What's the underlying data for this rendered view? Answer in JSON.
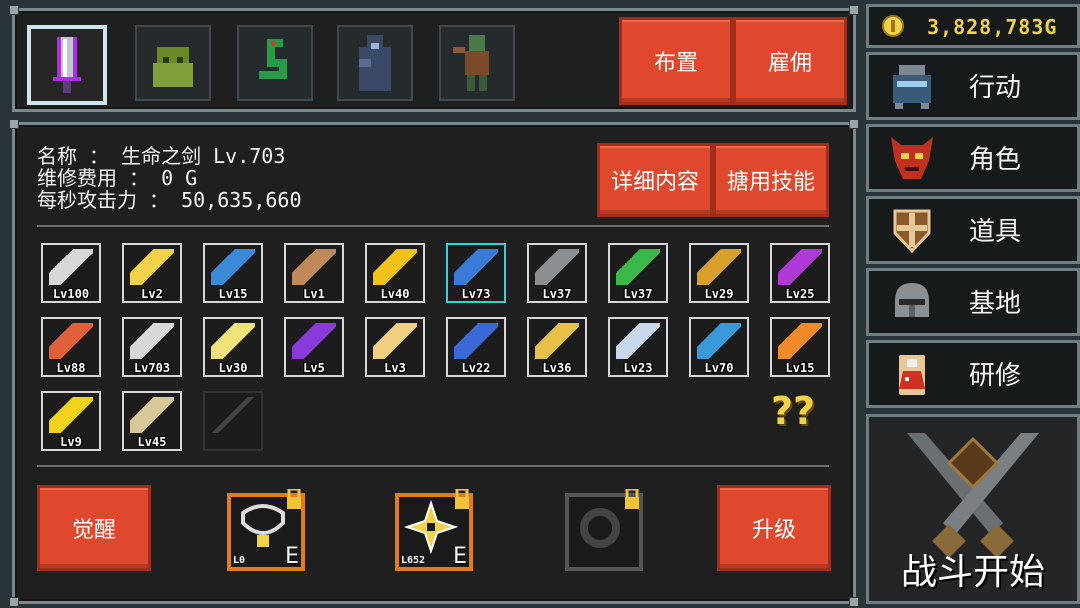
{
  "gold": "3,828,783G",
  "top_buttons": {
    "deploy": "布置",
    "hire": "雇佣"
  },
  "info": {
    "name_line": "名称 ： 生命之剑 Lv.703",
    "upkeep_line": "维修费用 ： 0 G",
    "attack_line": "每秒攻击力 ： 50,635,660"
  },
  "info_buttons": {
    "details": "详细内容",
    "skills": "搪用技能"
  },
  "skills_row1": [
    "Lv100",
    "Lv2",
    "Lv15",
    "Lv1",
    "Lv40",
    "Lv73",
    "Lv37",
    "Lv37",
    "Lv29",
    "Lv25"
  ],
  "skills_row2": [
    "Lv88",
    "Lv703",
    "Lv30",
    "Lv5",
    "Lv3",
    "Lv22",
    "Lv36",
    "Lv23",
    "Lv70",
    "Lv15"
  ],
  "skills_row3": [
    "Lv9",
    "Lv45"
  ],
  "question_mark": "??",
  "bottom": {
    "awaken": "觉醒",
    "upgrade": "升级",
    "equip1_level": "L0",
    "equip2_level": "L652",
    "equip_grade": "E"
  },
  "menu": [
    "行动",
    "角色",
    "道具",
    "基地",
    "研修"
  ],
  "battle_start": "战斗开始",
  "colors": {
    "button_red": "#e0482e",
    "gold": "#f2d24a",
    "selected_border": "#45c8d8"
  }
}
